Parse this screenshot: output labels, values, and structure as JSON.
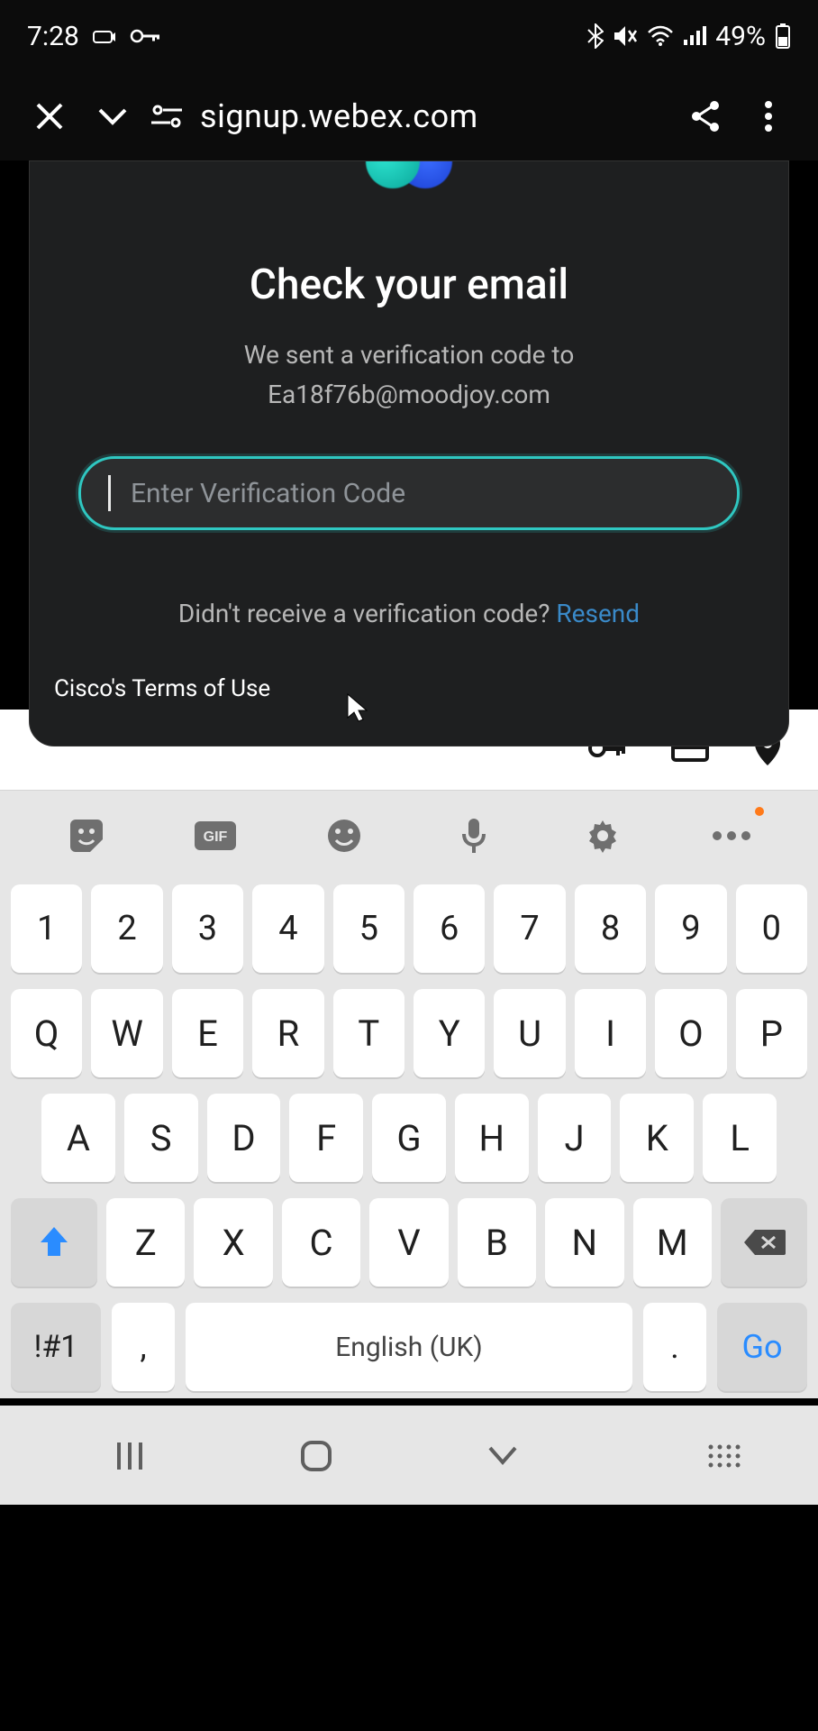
{
  "status": {
    "time": "7:28",
    "battery_text": "49%"
  },
  "browser": {
    "url": "signup.webex.com"
  },
  "card": {
    "title": "Check your email",
    "sub": "We sent a verification code to",
    "email": "Ea18f76b@moodjoy.com",
    "placeholder": "Enter Verification Code",
    "resend_q": "Didn't receive a verification code? ",
    "resend_link": "Resend"
  },
  "footer": {
    "terms": "Cisco's Terms of Use"
  },
  "keyboard": {
    "row_num": [
      "1",
      "2",
      "3",
      "4",
      "5",
      "6",
      "7",
      "8",
      "9",
      "0"
    ],
    "row1": [
      "Q",
      "W",
      "E",
      "R",
      "T",
      "Y",
      "U",
      "I",
      "O",
      "P"
    ],
    "row2": [
      "A",
      "S",
      "D",
      "F",
      "G",
      "H",
      "J",
      "K",
      "L"
    ],
    "row3": [
      "Z",
      "X",
      "C",
      "V",
      "B",
      "N",
      "M"
    ],
    "sym": "!#1",
    "comma": ",",
    "space": "English (UK)",
    "period": ".",
    "go": "Go"
  }
}
